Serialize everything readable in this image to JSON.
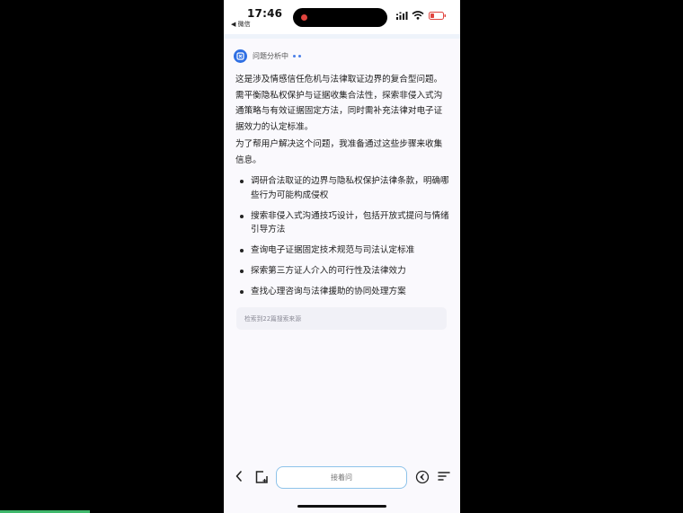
{
  "status_bar": {
    "time": "17:46",
    "back_app": "◀ 微信"
  },
  "assistant": {
    "status_text": "问题分析中",
    "intro": "这是涉及情感信任危机与法律取证边界的复合型问题。需平衡隐私权保护与证据收集合法性，探索非侵入式沟通策略与有效证据固定方法，同时需补充法律对电子证据效力的认定标准。",
    "plan_intro": "为了帮用户解决这个问题，我准备通过这些步骤来收集信息。",
    "steps": [
      "调研合法取证的边界与隐私权保护法律条款，明确哪些行为可能构成侵权",
      "搜索非侵入式沟通技巧设计，包括开放式提问与情绪引导方法",
      "查询电子证据固定技术规范与司法认定标准",
      "探索第三方证人介入的可行性及法律效力",
      "查找心理咨询与法律援助的协同处理方案"
    ],
    "sources_text": "检索到22篇搜索来源"
  },
  "bottom_bar": {
    "input_placeholder": "接着问"
  },
  "icons": {
    "ai_logo": "ai-logo-icon",
    "back": "chevron-left-icon",
    "new_chat": "new-chat-icon",
    "voice": "voice-icon",
    "menu": "menu-icon"
  },
  "colors": {
    "accent": "#2f6fe3",
    "input_border": "#8ec3ea",
    "record_dot": "#e0443e",
    "battery_low": "#e0443e"
  }
}
